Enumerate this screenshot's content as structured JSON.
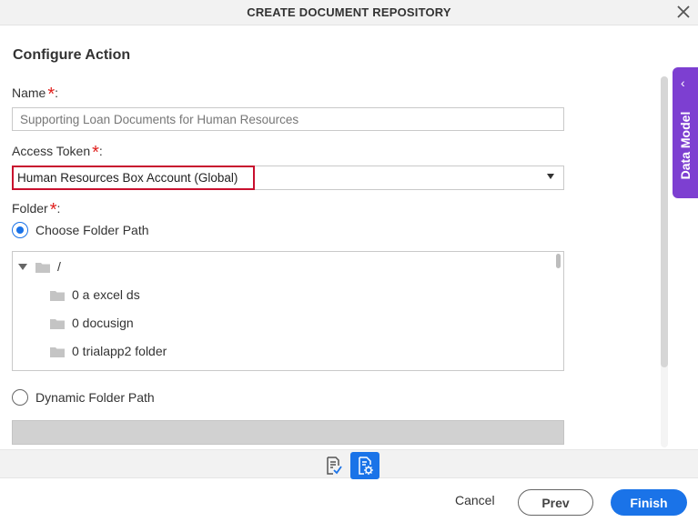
{
  "header": {
    "title": "CREATE DOCUMENT REPOSITORY"
  },
  "section": {
    "title": "Configure Action"
  },
  "name_field": {
    "label": "Name",
    "required_mark": "*",
    "colon": ":",
    "value": "Supporting Loan Documents for Human Resources"
  },
  "access_token": {
    "label": "Access Token",
    "required_mark": "*",
    "colon": ":",
    "selected": "Human Resources Box Account (Global)"
  },
  "folder": {
    "label": "Folder",
    "required_mark": "*",
    "colon": ":",
    "choose_option": {
      "label": "Choose Folder Path",
      "checked": true
    },
    "tree": {
      "root": {
        "label": "/",
        "expanded": true
      },
      "children": [
        {
          "label": "0 a excel ds"
        },
        {
          "label": "0 docusign"
        },
        {
          "label": "0 trialapp2 folder"
        }
      ]
    },
    "dynamic_option": {
      "label": "Dynamic Folder Path",
      "checked": false
    }
  },
  "side_panel": {
    "label": "Data Model",
    "chevron": "‹"
  },
  "toolbar": {
    "icons": [
      "form-validate-icon",
      "document-settings-icon"
    ],
    "active": "document-settings-icon"
  },
  "footer": {
    "cancel": "Cancel",
    "prev": "Prev",
    "finish": "Finish"
  },
  "colors": {
    "primary": "#1a73e8",
    "side_panel": "#7d3fd1",
    "required": "#e0201d",
    "highlight": "#c8102e"
  }
}
